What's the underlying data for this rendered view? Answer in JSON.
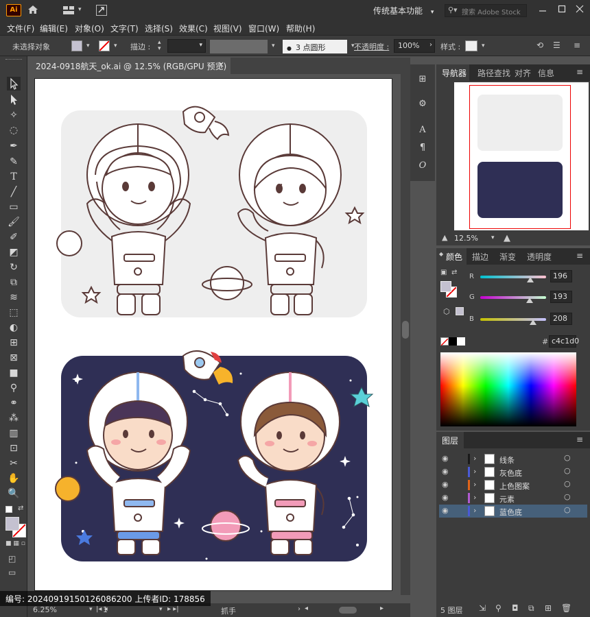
{
  "titlebar": {
    "logo": "Ai",
    "workspace": "传统基本功能",
    "search_placeholder": "搜索 Adobe Stock"
  },
  "menubar": {
    "items": [
      "文件(F)",
      "编辑(E)",
      "对象(O)",
      "文字(T)",
      "选择(S)",
      "效果(C)",
      "视图(V)",
      "窗口(W)",
      "帮助(H)"
    ]
  },
  "controlbar": {
    "no_selection": "未选择对象",
    "stroke_label": "描边 :",
    "brush_value": "3 点圆形",
    "opacity_label": "不透明度 :",
    "opacity_value": "100%",
    "style_label": "样式 :"
  },
  "document": {
    "tab_title": "2024-0918航天_ok.ai @ 12.5% (RGB/GPU 预览)"
  },
  "statusbar": {
    "zoom": "6.25%",
    "page": "1",
    "tool": "抓手"
  },
  "navigator": {
    "tabs": [
      "导航器",
      "路径查找",
      "对齐",
      "信息"
    ],
    "zoom": "12.5%"
  },
  "color_panel": {
    "tabs": [
      "颜色",
      "描边",
      "渐变",
      "透明度"
    ],
    "r_label": "R",
    "g_label": "G",
    "b_label": "B",
    "r_value": "196",
    "g_value": "193",
    "b_value": "208",
    "r": 196,
    "g": 193,
    "b": 208,
    "hex_label": "#",
    "hex_value": "c4c1d0",
    "fill_color": "#c4c1d0"
  },
  "layers_panel": {
    "tab": "图层",
    "layers": [
      {
        "name": "线条",
        "color": "#1a1a1a"
      },
      {
        "name": "灰色底",
        "color": "#4a5ad6"
      },
      {
        "name": "上色图案",
        "color": "#e0641a"
      },
      {
        "name": "元素",
        "color": "#b05ad0"
      },
      {
        "name": "蓝色底",
        "color": "#4a5ad6"
      }
    ],
    "count": "5 图层"
  },
  "watermark": {
    "text": "编号: 20240919150126086200   上传者ID: 178856"
  }
}
